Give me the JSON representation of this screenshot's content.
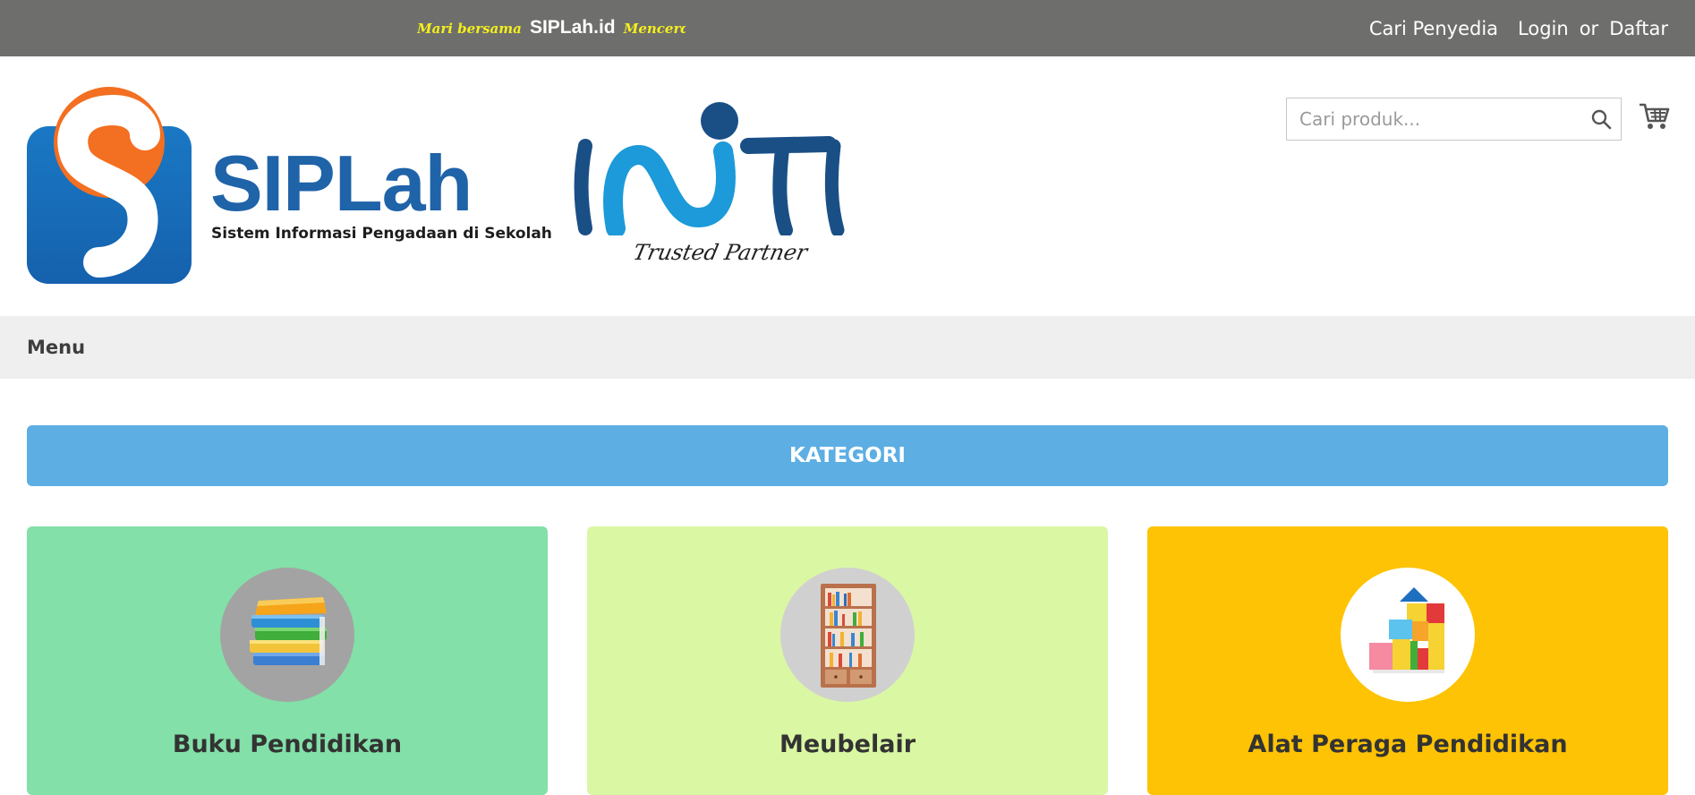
{
  "topbar": {
    "marquee_script_left": "Mari bersama",
    "marquee_brand": "SIPLah.id",
    "marquee_script_right": "Mencerdaskan",
    "links": {
      "cari_penyedia": "Cari Penyedia",
      "login": "Login",
      "or": "or",
      "daftar": "Daftar"
    },
    "colors": {
      "background": "#6e6f6c",
      "script_text": "#f5ee1e"
    }
  },
  "header": {
    "siplah_logo": {
      "word": "SIPLah",
      "tagline": "Sistem Informasi Pengadaan di Sekolah"
    },
    "partner_logo": {
      "word": "INTI",
      "tagline": "Trusted Partner"
    },
    "search": {
      "placeholder": "Cari produk..."
    },
    "cart_icon": "shopping-cart-icon",
    "search_icon": "search-icon"
  },
  "menubar": {
    "label": "Menu"
  },
  "kategori": {
    "title": "KATEGORI",
    "color": "#5caee3"
  },
  "categories": [
    {
      "title": "Buku Pendidikan",
      "background": "#82e0a8",
      "icon": "books-icon"
    },
    {
      "title": "Meubelair",
      "background": "#daf7a4",
      "icon": "bookshelf-icon"
    },
    {
      "title": "Alat Peraga Pendidikan",
      "background": "#fec304",
      "icon": "toy-blocks-icon"
    }
  ]
}
